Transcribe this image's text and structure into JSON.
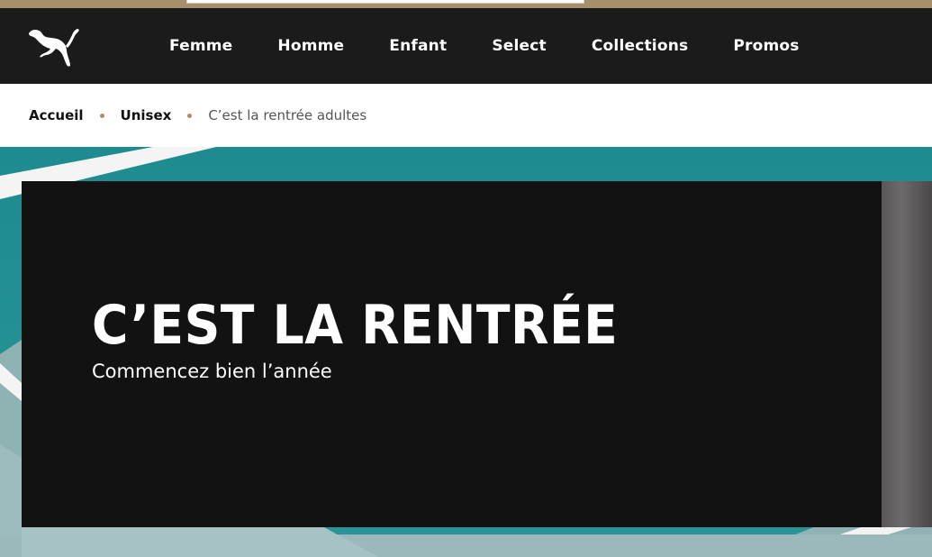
{
  "brand": {
    "logo": "puma-logo-icon"
  },
  "nav": {
    "items": [
      {
        "label": "Femme"
      },
      {
        "label": "Homme"
      },
      {
        "label": "Enfant"
      },
      {
        "label": "Select"
      },
      {
        "label": "Collections"
      },
      {
        "label": "Promos"
      }
    ]
  },
  "breadcrumb": {
    "items": [
      {
        "label": "Accueil"
      },
      {
        "label": "Unisex"
      },
      {
        "label": "C’est la rentrée adultes"
      }
    ]
  },
  "hero": {
    "title": "C’EST LA RENTRÉE",
    "subtitle": "Commencez bien l’année"
  },
  "colors": {
    "top_strip": "#a88f6c",
    "nav_bg": "#1b1b1b",
    "breadcrumb_separator": "#a88f6c",
    "hero_panel": "#121212",
    "court_teal": "#1f8c90",
    "court_light": "#8fb2b3"
  }
}
